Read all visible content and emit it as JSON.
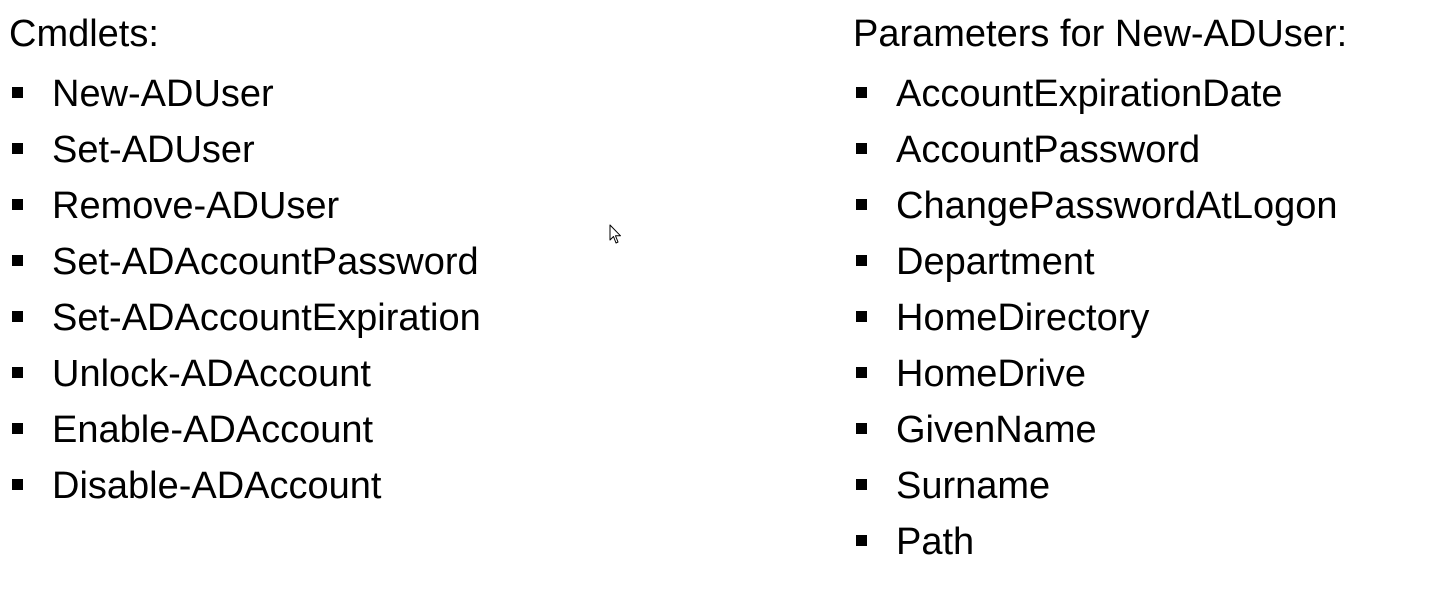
{
  "left": {
    "heading": "Cmdlets:",
    "items": [
      "New-ADUser",
      "Set-ADUser",
      "Remove-ADUser",
      "Set-ADAccountPassword",
      "Set-ADAccountExpiration",
      "Unlock-ADAccount",
      "Enable-ADAccount",
      "Disable-ADAccount"
    ]
  },
  "right": {
    "heading_prefix": "Parameters for ",
    "heading_cmdlet": "New-ADUser:",
    "items": [
      "AccountExpirationDate",
      "AccountPassword",
      "ChangePasswordAtLogon",
      "Department",
      "HomeDirectory",
      "HomeDrive",
      "GivenName",
      "Surname",
      "Path"
    ]
  },
  "icons": {
    "bullet": "square-bullet-icon",
    "cursor": "mouse-pointer-icon"
  }
}
